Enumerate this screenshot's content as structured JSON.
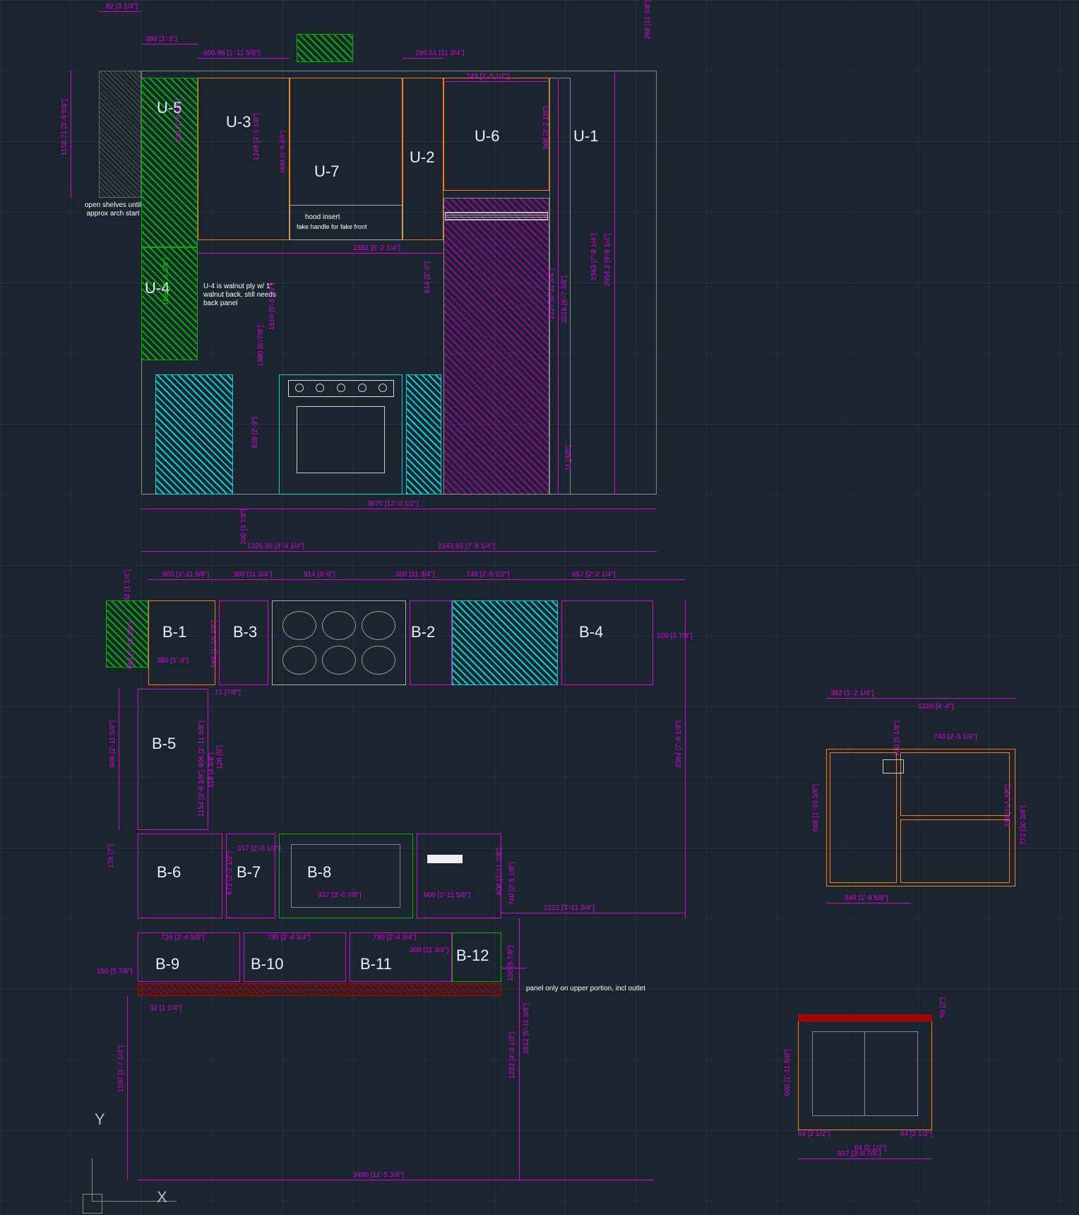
{
  "units": {
    "upper": {
      "u1": "U-1",
      "u2": "U-2",
      "u3": "U-3",
      "u4": "U-4",
      "u5": "U-5",
      "u6": "U-6",
      "u7": "U-7"
    },
    "base": {
      "b1": "B-1",
      "b2": "B-2",
      "b3": "B-3",
      "b4": "B-4",
      "b5": "B-5",
      "b6": "B-6",
      "b7": "B-7",
      "b8": "B-8",
      "b9": "B-9",
      "b10": "B-10",
      "b11": "B-11",
      "b12": "B-12"
    }
  },
  "dimensions": {
    "d82": "82 [3 1/4\"]",
    "d288": "288 [11 3/8\"]",
    "d380a": "380 [1'-3\"]",
    "d60096": "600.96 [1'-11 5/8\"]",
    "d29951": "299.51 [11 3/4\"]",
    "d749": "749 [2'-5 1/2\"]",
    "d115871": "1158.71 [3'-9 5/8\"]",
    "d520": "520 [1'-8 1/2\"]",
    "d1248": "1248 [4'-1 1/8\"]",
    "d968": "968 [3'-2 1/8\"]",
    "d1684": "1684 [5'-5 3/8\"]",
    "d1582": "1582 [5'-2 1/4\"]",
    "d614": "614 [2'-0\"]",
    "d1610": "1610 [5'-3 1/2\"]",
    "d2016": "2016 [6'-7 3/8\"]",
    "d2127": "2127 [6'-11 3/4\"]",
    "d29543": "2954.3 [9'-8 1/4\"]",
    "d2343": "2343 [7'-8 1/4\"]",
    "d1380": "1380 [6'-7/8\"]",
    "d838": "838 [2'-9\"]",
    "d3670": "3670 [12'-0 1/2\"]",
    "d11": "11 [3/8\"]",
    "d132636": "1326.36 [4'-4 1/4\"]",
    "d234392": "2343.92 [7'-8 1/4\"]",
    "d32": "32 [1 1/4\"]",
    "d600": "600 [1'-11 5/8\"]",
    "d300": "300 [11 3/4\"]",
    "d914": "914 [3'-0\"]",
    "d300b": "300 [11 3/4\"]",
    "d749b": "749 [2'-5 1/2\"]",
    "d657": "657 [2'-2 1/4\"]",
    "d380": "380 [1'-3\"]",
    "d568": "568 [1'-10 3/8\"]",
    "d100": "100 [3 7/8\"]",
    "d2364": "2364 [7'-9 1/8\"]",
    "d178": "178 [7\"]",
    "d906": "906 [2'-11 5/8\"]",
    "d1154": "1154 [3'-9 3/8\"]",
    "d128": "128 [5\"]",
    "d118": "118 [4 5/8\"]",
    "d21": "21 [7/8\"]",
    "d672": "672 [2'-2 1/2\"]",
    "d317": "317 [1'-0 1/2\"]",
    "d937": "937 [3'-0 7/8\"]",
    "d600c": "600 [1'-11 5/8\"]",
    "d606": "606 [1'-11 7/8\"]",
    "d740": "740 [2'-5 1/8\"]",
    "d1212": "1212 [3'-11 3/4\"]",
    "d150": "150 [5 7/8\"]",
    "d726": "726 [2'-4 5/8\"]",
    "d730": "730 [2'-4 3/4\"]",
    "d730b": "730 [2'-4 3/4\"]",
    "d300c": "300 [11 3/4\"]",
    "d32b": "32 [1 1/4\"]",
    "d1100": "1100 [3'-7 1/4\"]",
    "d1232": "1232 [4'-0 1/2\"]",
    "d1812": "1812 [5'-11 3/8\"]",
    "d3490": "3490 [11'-5 3/8\"]",
    "d382": "382 [1'-2 1/4\"]",
    "d1320": "1320 [4'-4\"]",
    "d740b": "740 [2'-5 1/8\"]",
    "d130": "130 [5 1/8\"]",
    "d339": "339 [1'-1 3/8\"]",
    "d568b": "568 [1'-10 3/8\"]",
    "d548": "548 [1'-9 5/8\"]",
    "d772": "772 [30 3/8\"]",
    "d600d": "600 [1'-11 5/8\"]",
    "d64": "64 [2 1/2\"]",
    "d64b": "64 [2 1/2\"]",
    "d64c": "64 [2 1/2\"]",
    "d937b": "937 [3'-0 7/8\"]",
    "d50": "50 [2\"]"
  },
  "notes": {
    "shelves": "open shelves until approx arch start",
    "hood": "hood insert",
    "hood2": "fake handle for fake front",
    "u4note": "U-4 is walnut ply w/ 1\" walnut back, still needs back panel",
    "panel": "panel only on upper portion, incl outlet"
  },
  "axes": {
    "x": "X",
    "y": "Y"
  }
}
